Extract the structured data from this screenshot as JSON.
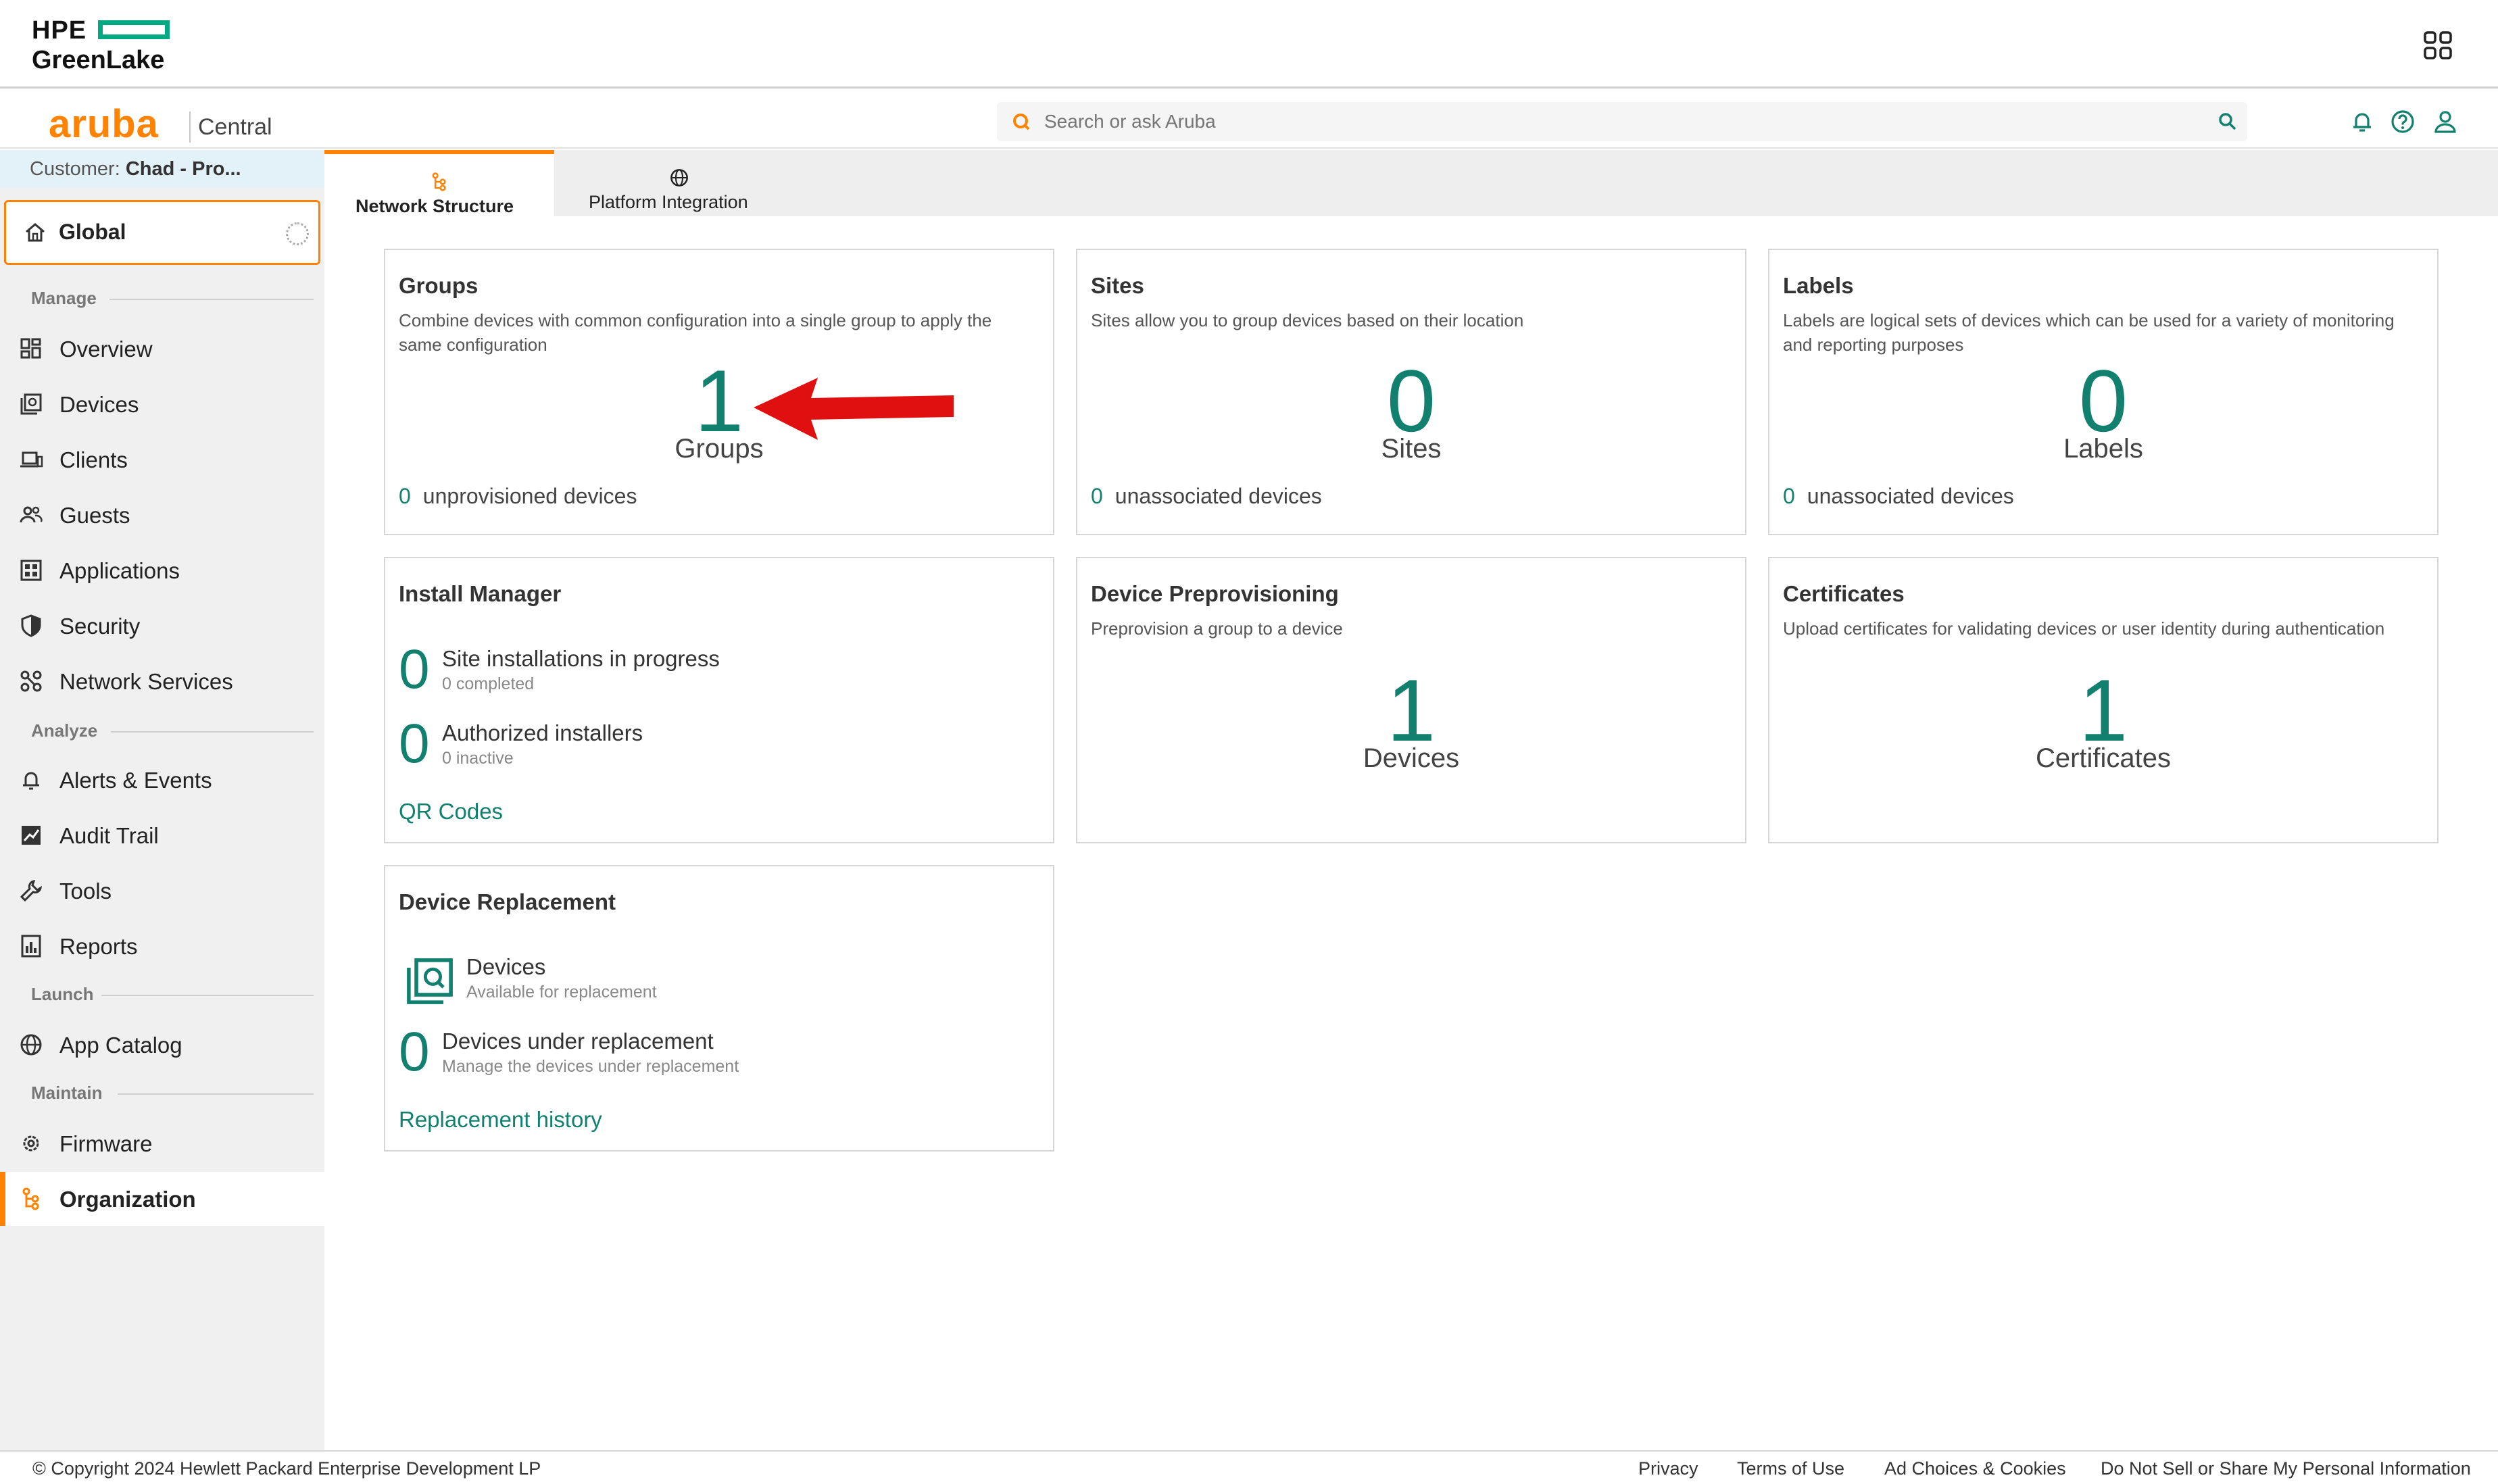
{
  "hpe": {
    "line1": "HPE",
    "line2": "GreenLake"
  },
  "aruba": {
    "logo": "aruba",
    "product": "Central"
  },
  "search": {
    "placeholder": "Search or ask Aruba"
  },
  "sidebar": {
    "customer_prefix": "Customer:",
    "customer_name": "Chad - Pro...",
    "scope": "Global",
    "sections": {
      "manage": "Manage",
      "analyze": "Analyze",
      "launch": "Launch",
      "maintain": "Maintain"
    },
    "items": {
      "overview": "Overview",
      "devices": "Devices",
      "clients": "Clients",
      "guests": "Guests",
      "applications": "Applications",
      "security": "Security",
      "network_services": "Network Services",
      "alerts": "Alerts & Events",
      "audit": "Audit Trail",
      "tools": "Tools",
      "reports": "Reports",
      "app_catalog": "App Catalog",
      "firmware": "Firmware",
      "organization": "Organization"
    }
  },
  "tabs": {
    "network_structure": "Network Structure",
    "platform_integration": "Platform Integration"
  },
  "cards": {
    "groups": {
      "title": "Groups",
      "desc": "Combine devices with common configuration into a single group to apply the same configuration",
      "count": "1",
      "unit": "Groups",
      "foot_num": "0",
      "foot_label": "unprovisioned devices"
    },
    "sites": {
      "title": "Sites",
      "desc": "Sites allow you to group devices based on their location",
      "count": "0",
      "unit": "Sites",
      "foot_num": "0",
      "foot_label": "unassociated devices"
    },
    "labels": {
      "title": "Labels",
      "desc": "Labels are logical sets of devices which can be used for a variety of monitoring and reporting purposes",
      "count": "0",
      "unit": "Labels",
      "foot_num": "0",
      "foot_label": "unassociated devices"
    },
    "install_manager": {
      "title": "Install Manager",
      "row1_num": "0",
      "row1_title": "Site installations in progress",
      "row1_sub": "0 completed",
      "row2_num": "0",
      "row2_title": "Authorized installers",
      "row2_sub": "0 inactive",
      "link": "QR Codes"
    },
    "preprov": {
      "title": "Device Preprovisioning",
      "desc": "Preprovision a group to a device",
      "count": "1",
      "unit": "Devices"
    },
    "certificates": {
      "title": "Certificates",
      "desc": "Upload certificates for validating devices or user identity during authentication",
      "count": "1",
      "unit": "Certificates"
    },
    "replacement": {
      "title": "Device Replacement",
      "row1_title": "Devices",
      "row1_sub": "Available for replacement",
      "row2_num": "0",
      "row2_title": "Devices under replacement",
      "row2_sub": "Manage the devices under replacement",
      "link": "Replacement history"
    }
  },
  "footer": {
    "copyright": "© Copyright 2024 Hewlett Packard Enterprise Development LP",
    "privacy": "Privacy",
    "terms": "Terms of Use",
    "adchoices": "Ad Choices & Cookies",
    "donotsell": "Do Not Sell or Share My Personal Information"
  },
  "colors": {
    "accent": "#ff8300",
    "teal": "#12806e",
    "hpe_green": "#01a982",
    "arrow": "#e01010"
  }
}
